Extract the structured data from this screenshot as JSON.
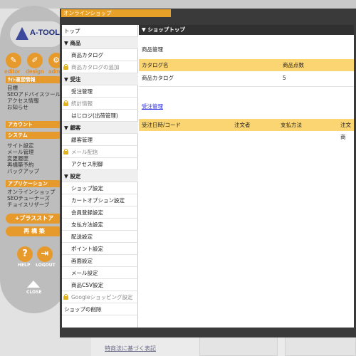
{
  "tool_panel": {
    "logo_text": "A-TOOL",
    "buttons": [
      {
        "label": "editor",
        "icon": "pencil-icon"
      },
      {
        "label": "design",
        "icon": "brush-icon"
      },
      {
        "label": "adm",
        "icon": "gear-icon"
      }
    ],
    "sections": [
      {
        "title": "ｻｲﾄ運営情報",
        "items": [
          "目標",
          "SEOアドバイスツール",
          "アクセス情報",
          "お知らせ"
        ]
      },
      {
        "title": "アカウント",
        "items": []
      },
      {
        "title": "システム",
        "items": [
          "サイト設定",
          "メール管理",
          "変更履歴",
          "再構築予約",
          "バックアップ"
        ]
      },
      {
        "title": "アプリケーション",
        "items": [
          "オンラインショップ",
          "SEOチューナーズ",
          "チョイスリザーブ"
        ]
      }
    ],
    "plus_store_label": "+プラスストア",
    "rebuild_label": "再 構 築",
    "help_label": "HELP",
    "logout_label": "LOGOUT",
    "close_label": "CLOSE"
  },
  "background": {
    "link1": "",
    "link2": "特商法に基づく表記"
  },
  "dialog": {
    "title": "オンラインショップ",
    "nav": [
      {
        "type": "top",
        "label": "トップ"
      },
      {
        "type": "section",
        "label": "▼ 商品"
      },
      {
        "type": "item",
        "label": "商品カタログ"
      },
      {
        "type": "locked",
        "label": "商品カタログの追加"
      },
      {
        "type": "section",
        "label": "▼ 受注"
      },
      {
        "type": "item",
        "label": "受注管理"
      },
      {
        "type": "locked",
        "label": "統計情報"
      },
      {
        "type": "item",
        "label": "はじロジ(出荷管理)"
      },
      {
        "type": "section",
        "label": "▼ 顧客"
      },
      {
        "type": "item",
        "label": "顧客管理"
      },
      {
        "type": "locked",
        "label": "メール配信"
      },
      {
        "type": "item",
        "label": "アクセス制御"
      },
      {
        "type": "section",
        "label": "▼ 設定"
      },
      {
        "type": "item",
        "label": "ショップ設定"
      },
      {
        "type": "item",
        "label": "カートオプション設定"
      },
      {
        "type": "item",
        "label": "会員登録設定"
      },
      {
        "type": "item",
        "label": "支払方法設定"
      },
      {
        "type": "item",
        "label": "配送設定"
      },
      {
        "type": "item",
        "label": "ポイント設定"
      },
      {
        "type": "item",
        "label": "画面設定"
      },
      {
        "type": "item",
        "label": "メール設定"
      },
      {
        "type": "item",
        "label": "商品CSV設定"
      },
      {
        "type": "locked",
        "label": "Googleショッピング設定"
      },
      {
        "type": "top",
        "label": "ショップの削除"
      }
    ],
    "main": {
      "header": "▼ ショップトップ",
      "subtitle": "商品管理",
      "catalog_table": {
        "columns": [
          "カタログ名",
          "商品点数"
        ],
        "rows": [
          [
            "商品カタログ",
            "5"
          ]
        ]
      },
      "order_link": "受注管理",
      "order_table": {
        "columns": [
          "受注日時/コード",
          "注文者",
          "支払方法",
          "注文商"
        ]
      }
    }
  }
}
